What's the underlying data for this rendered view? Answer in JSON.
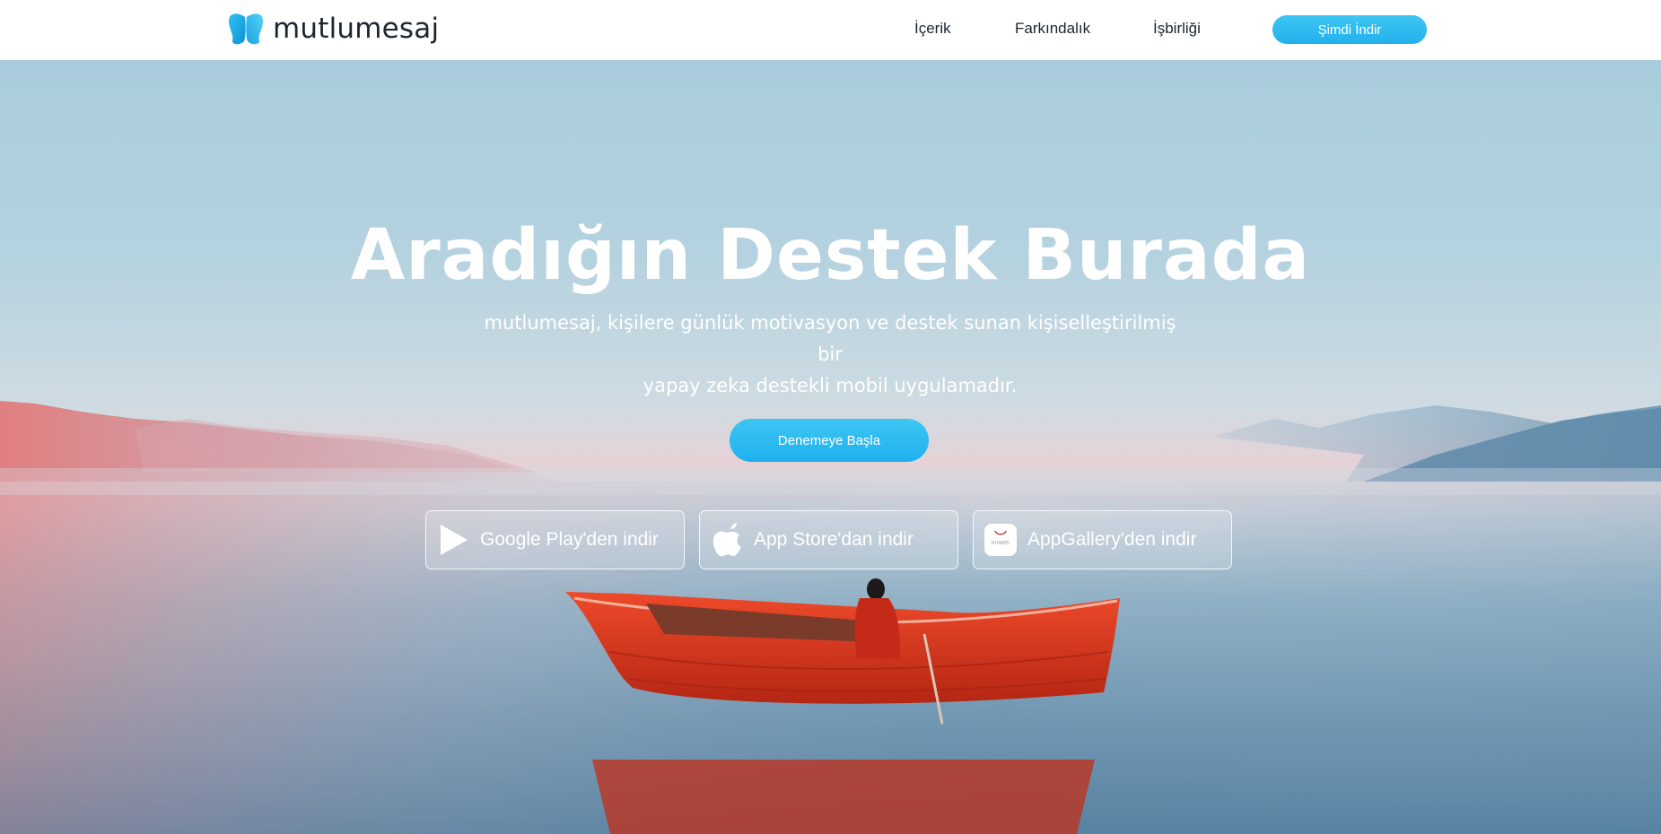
{
  "brand": {
    "name": "mutlumesaj"
  },
  "nav": {
    "items": [
      {
        "label": "İçerik"
      },
      {
        "label": "Farkındalık"
      },
      {
        "label": "İşbirliği"
      }
    ],
    "cta_label": "Şimdi İndir"
  },
  "hero": {
    "title": "Aradığın Destek Burada",
    "subtitle_line1": "mutlumesaj, kişilere günlük motivasyon ve destek sunan kişiselleştirilmiş bir",
    "subtitle_line2": "yapay zeka destekli mobil uygulamadır.",
    "cta_label": "Denemeye Başla",
    "stores": [
      {
        "label": "Google Play'den indir",
        "icon": "google-play-icon"
      },
      {
        "label": "App Store'dan indir",
        "icon": "apple-icon"
      },
      {
        "label": "AppGallery'den indir",
        "icon": "huawei-appgallery-icon",
        "badge_text": "HUAWEI"
      }
    ]
  },
  "colors": {
    "accent": "#2bb9f0",
    "text_dark": "#1d2430",
    "boat_red": "#d8371e"
  }
}
